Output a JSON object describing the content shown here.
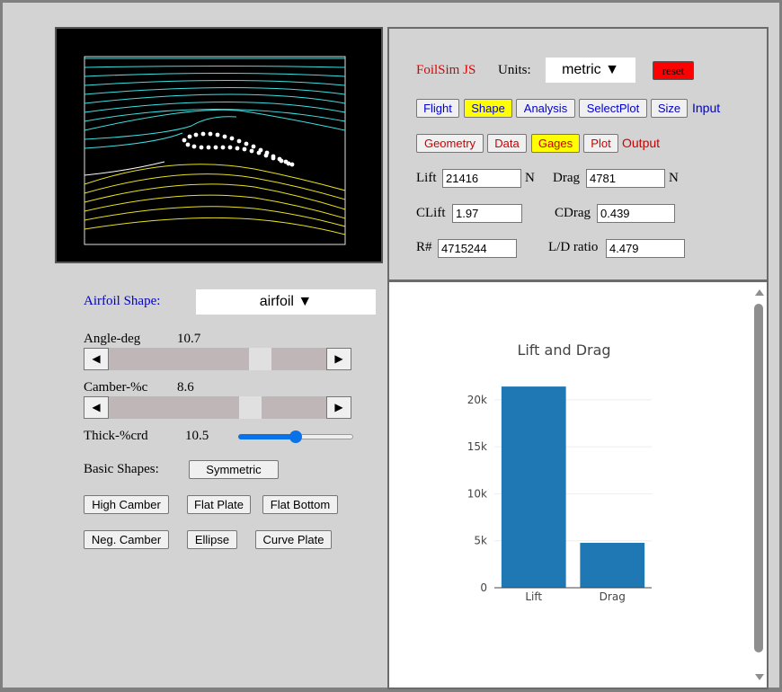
{
  "header": {
    "brand": "FoilSim JS",
    "units_label": "Units:",
    "units_value": "metric ▼",
    "reset_label": "reset"
  },
  "input_buttons": [
    {
      "label": "Flight",
      "selected": false
    },
    {
      "label": "Shape",
      "selected": true
    },
    {
      "label": "Analysis",
      "selected": false
    },
    {
      "label": "SelectPlot",
      "selected": false
    },
    {
      "label": "Size",
      "selected": false
    }
  ],
  "input_tag": "Input",
  "output_buttons": [
    {
      "label": "Geometry",
      "selected": false
    },
    {
      "label": "Data",
      "selected": false
    },
    {
      "label": "Gages",
      "selected": true
    },
    {
      "label": "Plot",
      "selected": false
    }
  ],
  "output_tag": "Output",
  "results": {
    "lift_label": "Lift",
    "lift_value": "21416",
    "lift_unit": "N",
    "drag_label": "Drag",
    "drag_value": "4781",
    "drag_unit": "N",
    "clift_label": "CLift",
    "clift_value": "1.97",
    "cdrag_label": "CDrag",
    "cdrag_value": "0.439",
    "re_label": "R#",
    "re_value": "4715244",
    "ld_label": "L/D ratio",
    "ld_value": "4.479"
  },
  "shape": {
    "airfoil_label": "Airfoil Shape:",
    "airfoil_value": "airfoil ▼",
    "angle_label": "Angle-deg",
    "angle_value": "10.7",
    "angle_frac": 0.72,
    "camber_label": "Camber-%c",
    "camber_value": "8.6",
    "camber_frac": 0.67,
    "thick_label": "Thick-%crd",
    "thick_value": "10.5",
    "thick_frac": 0.5,
    "basic_label": "Basic Shapes:",
    "buttons": [
      "Symmetric",
      "High Camber",
      "Flat Plate",
      "Flat Bottom",
      "Neg. Camber",
      "Ellipse",
      "Curve Plate"
    ]
  },
  "chart_data": {
    "type": "bar",
    "title": "Lift and Drag",
    "categories": [
      "Lift",
      "Drag"
    ],
    "values": [
      21416,
      4781
    ],
    "ylim": [
      0,
      22000
    ],
    "yticks": [
      0,
      5000,
      10000,
      15000,
      20000
    ],
    "ytick_labels": [
      "0",
      "5k",
      "10k",
      "15k",
      "20k"
    ],
    "bar_color": "#1f77b4",
    "grid": true
  }
}
